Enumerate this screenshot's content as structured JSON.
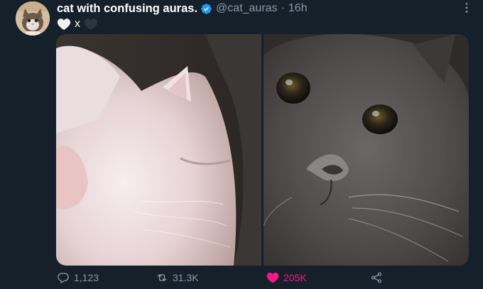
{
  "author": {
    "display_name": "cat with confusing auras.",
    "handle": "@cat_auras",
    "separator": "·",
    "time": "16h"
  },
  "tweet": {
    "text_separator": "x"
  },
  "media": {
    "images": [
      {
        "description_icon": "white-cat-photo"
      },
      {
        "description_icon": "gray-cat-photo"
      }
    ]
  },
  "actions": {
    "reply_count": "1,123",
    "retweet_count": "31.3K",
    "like_count": "205K"
  },
  "colors": {
    "background": "#15202b",
    "secondary_text": "#8899a6",
    "verified_blue": "#1d9bf0",
    "like_pink": "#f91880"
  }
}
